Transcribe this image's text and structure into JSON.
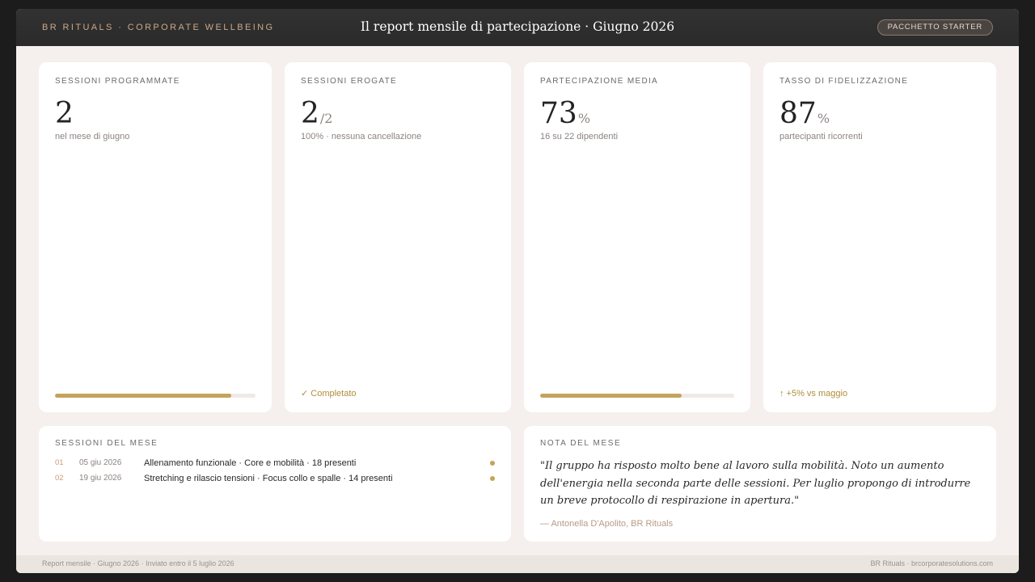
{
  "header": {
    "brand": "BR RITUALS · CORPORATE WELLBEING",
    "title": "Il report mensile di partecipazione · Giugno 2026",
    "package_badge": "PACCHETTO STARTER"
  },
  "kpis": [
    {
      "label": "SESSIONI PROGRAMMATE",
      "value": "2",
      "suffix": "",
      "sub": "nel mese di giugno",
      "footer_type": "bar",
      "progress": 0.88,
      "footer_text": ""
    },
    {
      "label": "SESSIONI EROGATE",
      "value": "2",
      "suffix": "/2",
      "sub": "100% · nessuna cancellazione",
      "footer_type": "text",
      "progress": null,
      "footer_text": "✓ Completato"
    },
    {
      "label": "PARTECIPAZIONE MEDIA",
      "value": "73",
      "suffix": "%",
      "sub": "16 su 22 dipendenti",
      "footer_type": "bar",
      "progress": 0.73,
      "footer_text": ""
    },
    {
      "label": "TASSO DI FIDELIZZAZIONE",
      "value": "87",
      "suffix": "%",
      "sub": "partecipanti ricorrenti",
      "footer_type": "text",
      "progress": null,
      "footer_text": "↑ +5% vs maggio"
    }
  ],
  "sessions": {
    "label": "SESSIONI DEL MESE",
    "items": [
      {
        "num": "01",
        "date": "05 giu 2026",
        "desc": "Allenamento funzionale · Core e mobilità · 18 presenti"
      },
      {
        "num": "02",
        "date": "19 giu 2026",
        "desc": "Stretching e rilascio tensioni · Focus collo e spalle · 14 presenti"
      }
    ]
  },
  "note": {
    "label": "NOTA DEL MESE",
    "quote": "\"Il gruppo ha risposto molto bene al lavoro sulla mobilità. Noto un aumento dell'energia nella seconda parte delle sessioni. Per luglio propongo di introdurre un breve protocollo di respirazione in apertura.\"",
    "author": "— Antonella D'Apolito, BR Rituals"
  },
  "footer": {
    "left": "Report mensile · Giugno 2026 · Inviato entro il 5 luglio 2026",
    "right": "BR Rituals · brcorporatesolutions.com"
  },
  "colors": {
    "accent_gold": "#c4a35a",
    "background": "#f5f0ed",
    "topbar": "#2e2d2d"
  }
}
